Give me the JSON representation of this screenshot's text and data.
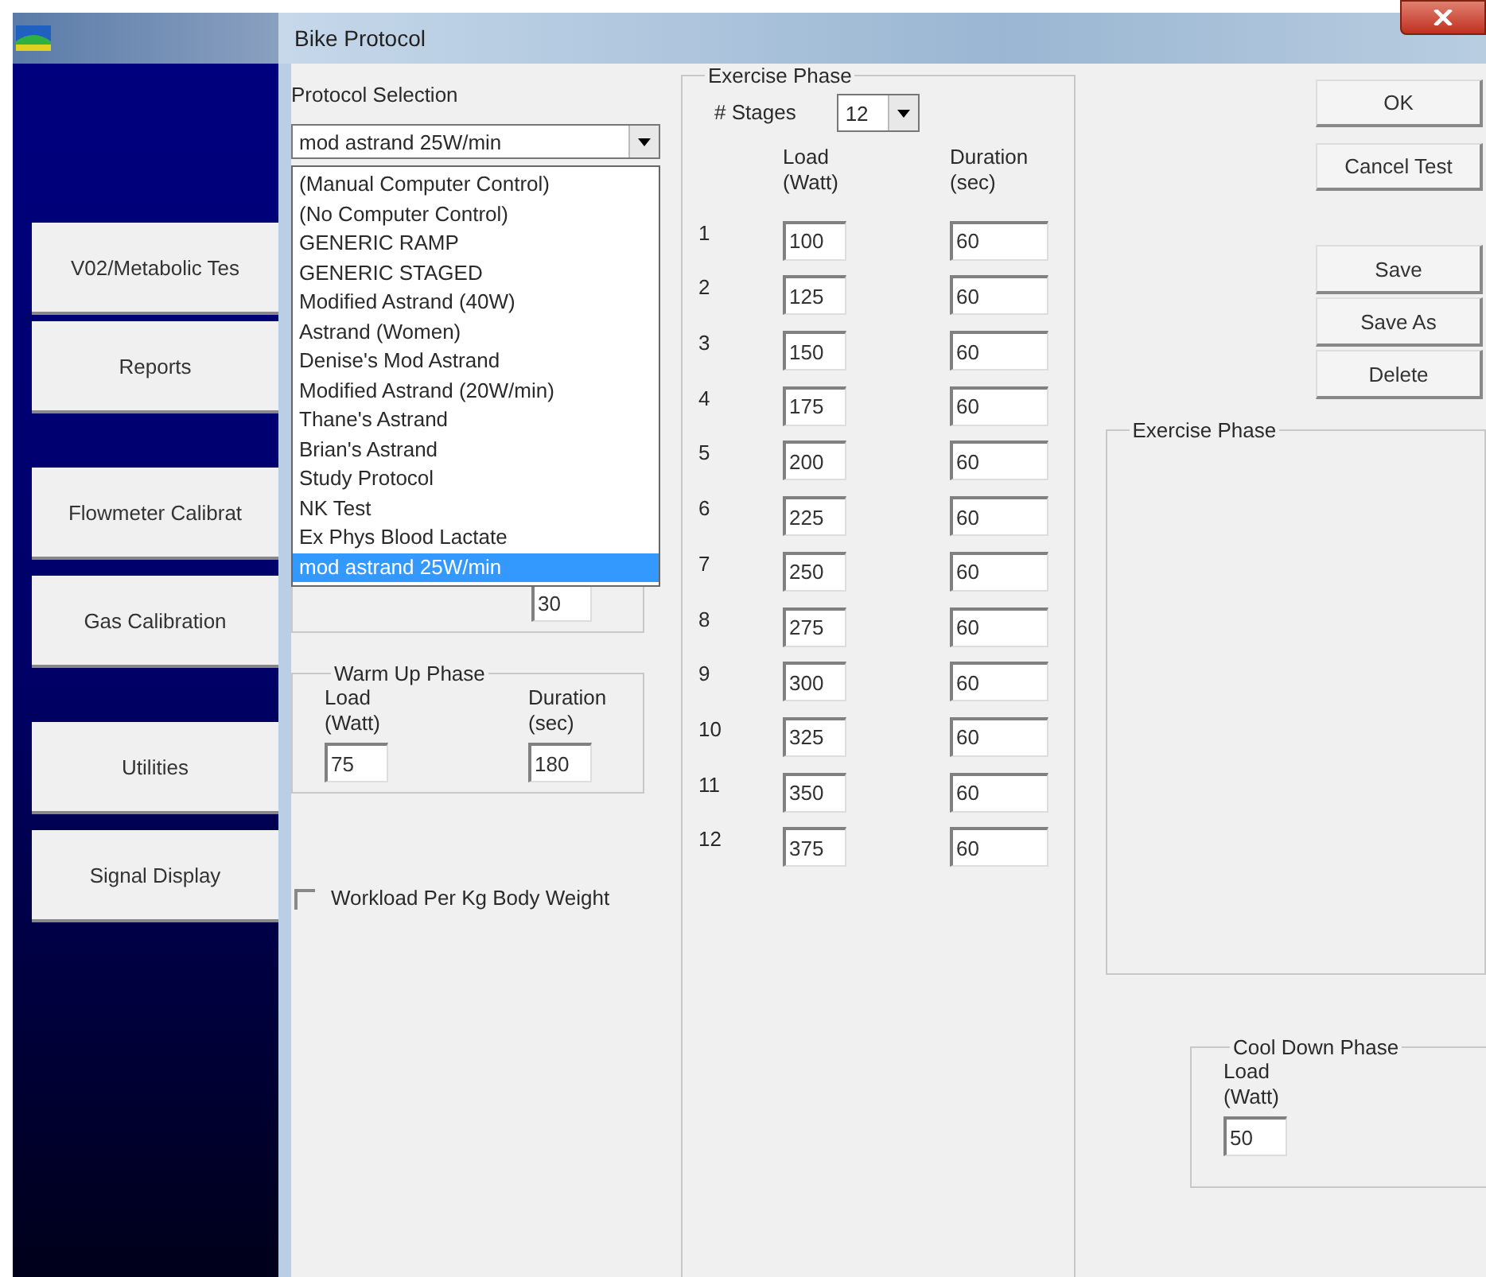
{
  "app": {
    "buttons": [
      "V02/Metabolic Tes",
      "Reports",
      "Flowmeter Calibrat",
      "Gas Calibration",
      "Utilities",
      "Signal Display"
    ]
  },
  "dialog": {
    "title": "Bike Protocol",
    "protocol_selection": {
      "label": "Protocol Selection",
      "value": "mod astrand 25W/min",
      "options": [
        {
          "label": "(Manual Computer Control)",
          "selected": false
        },
        {
          "label": "(No Computer Control)",
          "selected": false
        },
        {
          "label": "GENERIC RAMP",
          "selected": false
        },
        {
          "label": "GENERIC STAGED",
          "selected": false
        },
        {
          "label": "Modified Astrand (40W)",
          "selected": false
        },
        {
          "label": "Astrand (Women)",
          "selected": false
        },
        {
          "label": "Denise's Mod Astrand",
          "selected": false
        },
        {
          "label": "Modified Astrand (20W/min)",
          "selected": false
        },
        {
          "label": "Thane's Astrand",
          "selected": false
        },
        {
          "label": "Brian's Astrand",
          "selected": false
        },
        {
          "label": "Study Protocol",
          "selected": false
        },
        {
          "label": "NK Test",
          "selected": false
        },
        {
          "label": "Ex Phys Blood Lactate",
          "selected": false
        },
        {
          "label": "mod astrand 25W/min",
          "selected": true
        }
      ]
    },
    "hidden_group": {
      "field_value": "30"
    },
    "warm_up": {
      "title": "Warm Up Phase",
      "load_label": "Load",
      "load_unit": "(Watt)",
      "duration_label": "Duration",
      "duration_unit": "(sec)",
      "load": "75",
      "duration": "180"
    },
    "workload_per_kg": {
      "label": "Workload Per Kg  Body Weight",
      "checked": false
    },
    "exercise_phase": {
      "title": "Exercise Phase",
      "stages_label": "# Stages",
      "stages": "12",
      "load_header": "Load",
      "load_unit": "(Watt)",
      "duration_header": "Duration",
      "duration_unit": "(sec)",
      "rows": [
        {
          "n": "1",
          "load": "100",
          "duration": "60"
        },
        {
          "n": "2",
          "load": "125",
          "duration": "60"
        },
        {
          "n": "3",
          "load": "150",
          "duration": "60"
        },
        {
          "n": "4",
          "load": "175",
          "duration": "60"
        },
        {
          "n": "5",
          "load": "200",
          "duration": "60"
        },
        {
          "n": "6",
          "load": "225",
          "duration": "60"
        },
        {
          "n": "7",
          "load": "250",
          "duration": "60"
        },
        {
          "n": "8",
          "load": "275",
          "duration": "60"
        },
        {
          "n": "9",
          "load": "300",
          "duration": "60"
        },
        {
          "n": "10",
          "load": "325",
          "duration": "60"
        },
        {
          "n": "11",
          "load": "350",
          "duration": "60"
        },
        {
          "n": "12",
          "load": "375",
          "duration": "60"
        }
      ]
    },
    "buttons_top": [
      "OK",
      "Cancel Test"
    ],
    "buttons_file": [
      "Save",
      "Save As",
      "Delete"
    ],
    "exercise_phase_panel": {
      "title": "Exercise Phase"
    },
    "cool_down": {
      "title": "Cool Down Phase",
      "load_label": "Load",
      "load_unit": "(Watt)",
      "load": "50"
    }
  }
}
